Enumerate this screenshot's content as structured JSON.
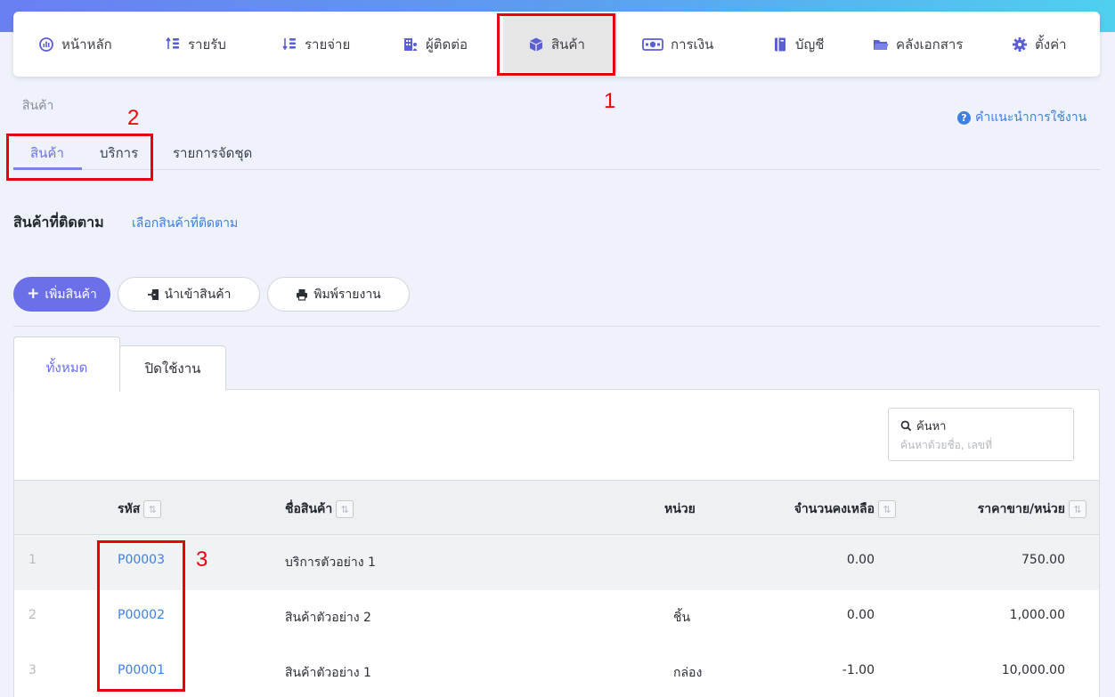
{
  "nav": {
    "items": [
      {
        "label": "หน้าหลัก",
        "icon": "dashboard-icon"
      },
      {
        "label": "รายรับ",
        "icon": "income-icon"
      },
      {
        "label": "รายจ่าย",
        "icon": "expense-icon"
      },
      {
        "label": "ผู้ติดต่อ",
        "icon": "contacts-icon"
      },
      {
        "label": "สินค้า",
        "icon": "box-icon"
      },
      {
        "label": "การเงิน",
        "icon": "money-icon"
      },
      {
        "label": "บัญชี",
        "icon": "ledger-icon"
      },
      {
        "label": "คลังเอกสาร",
        "icon": "folder-icon"
      },
      {
        "label": "ตั้งค่า",
        "icon": "gear-icon"
      }
    ],
    "active": "สินค้า"
  },
  "annotations": [
    "1",
    "2",
    "3"
  ],
  "breadcrumb": "สินค้า",
  "help_link": "คำแนะนำการใช้งาน",
  "subtabs": [
    "สินค้า",
    "บริการ",
    "รายการจัดชุด"
  ],
  "tracked": {
    "title": "สินค้าที่ติดตาม",
    "link": "เลือกสินค้าที่ติดตาม"
  },
  "buttons": {
    "add": "เพิ่มสินค้า",
    "import": "นำเข้าสินค้า",
    "print": "พิมพ์รายงาน"
  },
  "content_tabs": [
    "ทั้งหมด",
    "ปิดใช้งาน"
  ],
  "search": {
    "label": "ค้นหา",
    "placeholder": "ค้นหาด้วยชื่อ, เลขที่"
  },
  "table": {
    "headers": {
      "code": "รหัส",
      "name": "ชื่อสินค้า",
      "unit": "หน่วย",
      "qty": "จำนวนคงเหลือ",
      "price": "ราคาขาย/หน่วย"
    },
    "rows": [
      {
        "idx": "1",
        "code": "P00003",
        "name": "บริการตัวอย่าง 1",
        "unit": "",
        "qty": "0.00",
        "price": "750.00"
      },
      {
        "idx": "2",
        "code": "P00002",
        "name": "สินค้าตัวอย่าง 2",
        "unit": "ชิ้น",
        "qty": "0.00",
        "price": "1,000.00"
      },
      {
        "idx": "3",
        "code": "P00001",
        "name": "สินค้าตัวอย่าง 1",
        "unit": "กล่อง",
        "qty": "-1.00",
        "price": "10,000.00"
      }
    ]
  },
  "colors": {
    "accent": "#6b6fe8",
    "link": "#3d7fe3",
    "annotation": "#e8000b"
  }
}
